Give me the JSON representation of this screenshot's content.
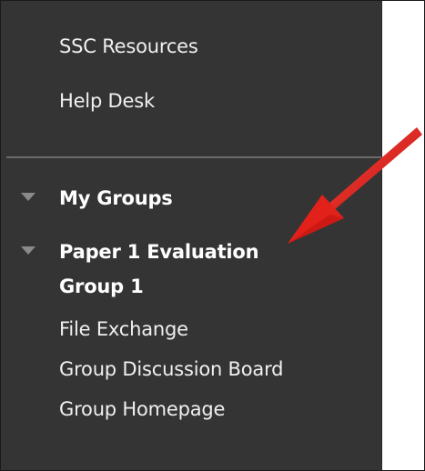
{
  "sidebar": {
    "top_links": [
      {
        "label": "SSC Resources"
      },
      {
        "label": "Help Desk"
      }
    ],
    "my_groups": {
      "label": "My Groups"
    },
    "group": {
      "label": "Paper 1 Evaluation Group 1",
      "tools": [
        {
          "label": "File Exchange"
        },
        {
          "label": "Group Discussion Board"
        },
        {
          "label": "Group Homepage"
        }
      ]
    }
  },
  "annotation": {
    "arrow_color": "#e8211c",
    "arrow_icon": "red-arrow-icon"
  },
  "colors": {
    "sidebar_bg": "#343434",
    "text": "#f0f0f0",
    "triangle": "#8a8a8a"
  }
}
